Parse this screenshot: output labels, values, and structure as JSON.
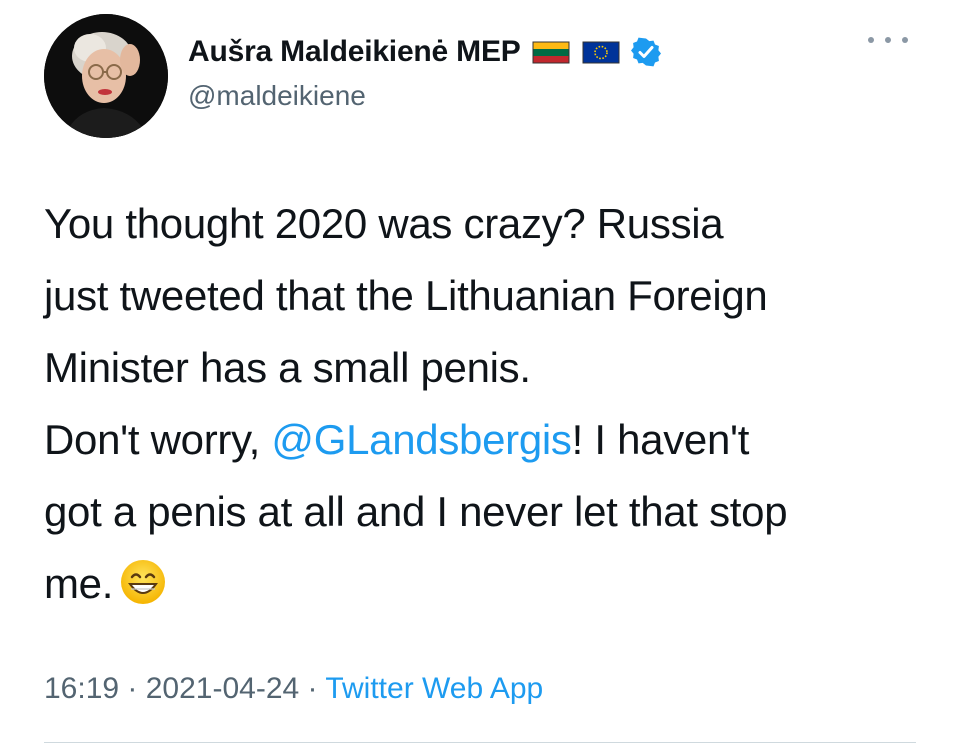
{
  "author": {
    "display_name": "Aušra Maldeikienė MEP",
    "handle": "@maldeikiene",
    "verified": true,
    "flags": [
      "lithuania-flag",
      "eu-flag"
    ]
  },
  "tweet": {
    "line1": "You thought 2020 was crazy? Russia",
    "line2": "just tweeted that the Lithuanian Foreign",
    "line3": "Minister has a small penis.",
    "line4_before": "Don't worry, ",
    "mention": "@GLandsbergis",
    "line4_after": "! I haven't",
    "line5": "got a penis at all and I never let that stop",
    "line6": "me.",
    "emoji": "grinning-face-emoji"
  },
  "meta": {
    "time": "16:19",
    "sep1": " · ",
    "date": "2021-04-24",
    "sep2": " · ",
    "source": "Twitter Web App"
  },
  "colors": {
    "link": "#1d9bf0",
    "secondary_text": "#536471",
    "primary_text": "#0f1419",
    "verified": "#1d9bf0"
  }
}
